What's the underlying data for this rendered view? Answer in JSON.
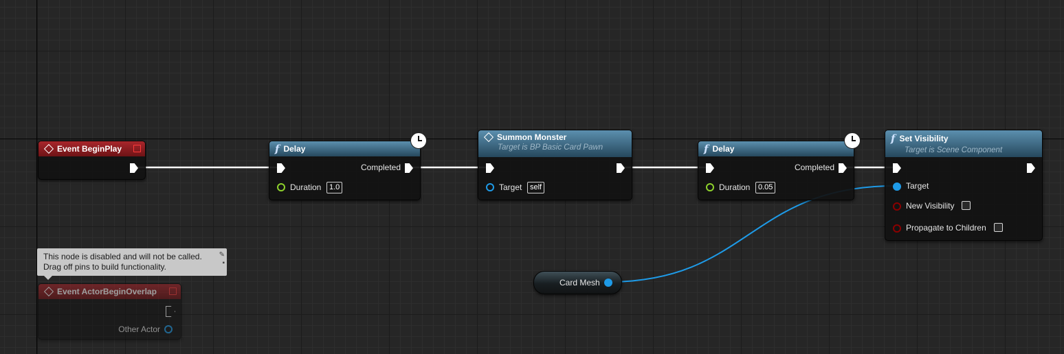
{
  "colors": {
    "exec_wire": "#ffffff",
    "object_wire": "#1e9be8",
    "float_pin": "#8ed22c",
    "bool_pin": "#8c0000",
    "object_pin": "#1e9be8"
  },
  "nodes": {
    "begin_play": {
      "title": "Event BeginPlay"
    },
    "delay1": {
      "title": "Delay",
      "out_label": "Completed",
      "duration_label": "Duration",
      "duration_value": "1.0"
    },
    "summon": {
      "title": "Summon Monster",
      "subtitle": "Target is BP Basic Card Pawn",
      "target_label": "Target",
      "target_value": "self"
    },
    "delay2": {
      "title": "Delay",
      "out_label": "Completed",
      "duration_label": "Duration",
      "duration_value": "0.05"
    },
    "set_visibility": {
      "title": "Set Visibility",
      "subtitle": "Target is Scene Component",
      "target_label": "Target",
      "new_visibility_label": "New Visibility",
      "propagate_label": "Propagate to Children"
    },
    "card_mesh": {
      "label": "Card Mesh"
    },
    "actor_begin_overlap": {
      "title": "Event ActorBeginOverlap",
      "other_actor_label": "Other Actor",
      "comment_line1": "This node is disabled and will not be called.",
      "comment_line2": "Drag off pins to build functionality."
    }
  }
}
